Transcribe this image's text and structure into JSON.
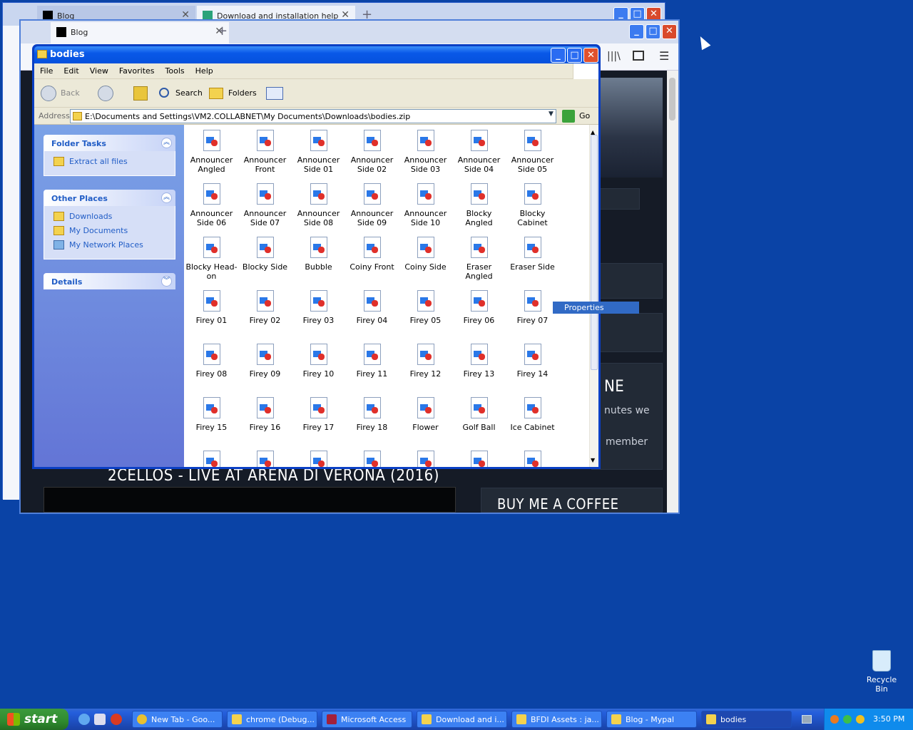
{
  "browser_back": {
    "tabs": [
      {
        "label": "Blog"
      },
      {
        "label": "Download and installation help"
      }
    ]
  },
  "browser_front": {
    "tab_label": "Blog",
    "web": {
      "video_title": "2CELLOS - LIVE AT ARENA DI VERONA (2016)",
      "sidebar_heading_fragment": "NE",
      "sidebar_text_1": "nutes we",
      "sidebar_text_2": "member",
      "buy_me_coffee": "BUY ME A COFFEE"
    }
  },
  "explorer": {
    "title": "bodies",
    "menu": [
      "File",
      "Edit",
      "View",
      "Favorites",
      "Tools",
      "Help"
    ],
    "toolbar": {
      "back": "Back",
      "search": "Search",
      "folders": "Folders"
    },
    "address_label": "Address",
    "address_value": "E:\\Documents and Settings\\VM2.COLLABNET\\My Documents\\Downloads\\bodies.zip",
    "go_label": "Go",
    "folder_tasks": {
      "title": "Folder Tasks",
      "items": [
        "Extract all files"
      ]
    },
    "other_places": {
      "title": "Other Places",
      "items": [
        "Downloads",
        "My Documents",
        "My Network Places"
      ]
    },
    "details": {
      "title": "Details"
    },
    "files": [
      "Announcer Angled",
      "Announcer Front",
      "Announcer Side 01",
      "Announcer Side 02",
      "Announcer Side 03",
      "Announcer Side 04",
      "Announcer Side 05",
      "Announcer Side 06",
      "Announcer Side 07",
      "Announcer Side 08",
      "Announcer Side 09",
      "Announcer Side 10",
      "Blocky Angled",
      "Blocky Cabinet",
      "Blocky Head-on",
      "Blocky Side",
      "Bubble",
      "Coiny Front",
      "Coiny Side",
      "Eraser Angled",
      "Eraser Side",
      "Firey 01",
      "Firey 02",
      "Firey 03",
      "Firey 04",
      "Firey 05",
      "Firey 06",
      "Firey 07",
      "Firey 08",
      "Firey 09",
      "Firey 10",
      "Firey 11",
      "Firey 12",
      "Firey 13",
      "Firey 14",
      "Firey 15",
      "Firey 16",
      "Firey 17",
      "Firey 18",
      "Flower",
      "Golf Ball",
      "Ice Cabinet",
      "",
      "",
      "",
      "",
      "",
      "",
      ""
    ],
    "context_menu_item": "Properties"
  },
  "desktop": {
    "recycle_bin": "Recycle Bin"
  },
  "taskbar": {
    "start": "start",
    "buttons": [
      {
        "label": "New Tab - Goo..."
      },
      {
        "label": "chrome (Debug..."
      },
      {
        "label": "Microsoft Access"
      },
      {
        "label": "Download and i..."
      },
      {
        "label": "BFDI Assets : ja..."
      },
      {
        "label": "Blog - Mypal"
      },
      {
        "label": "bodies"
      }
    ],
    "clock": "3:50 PM"
  }
}
